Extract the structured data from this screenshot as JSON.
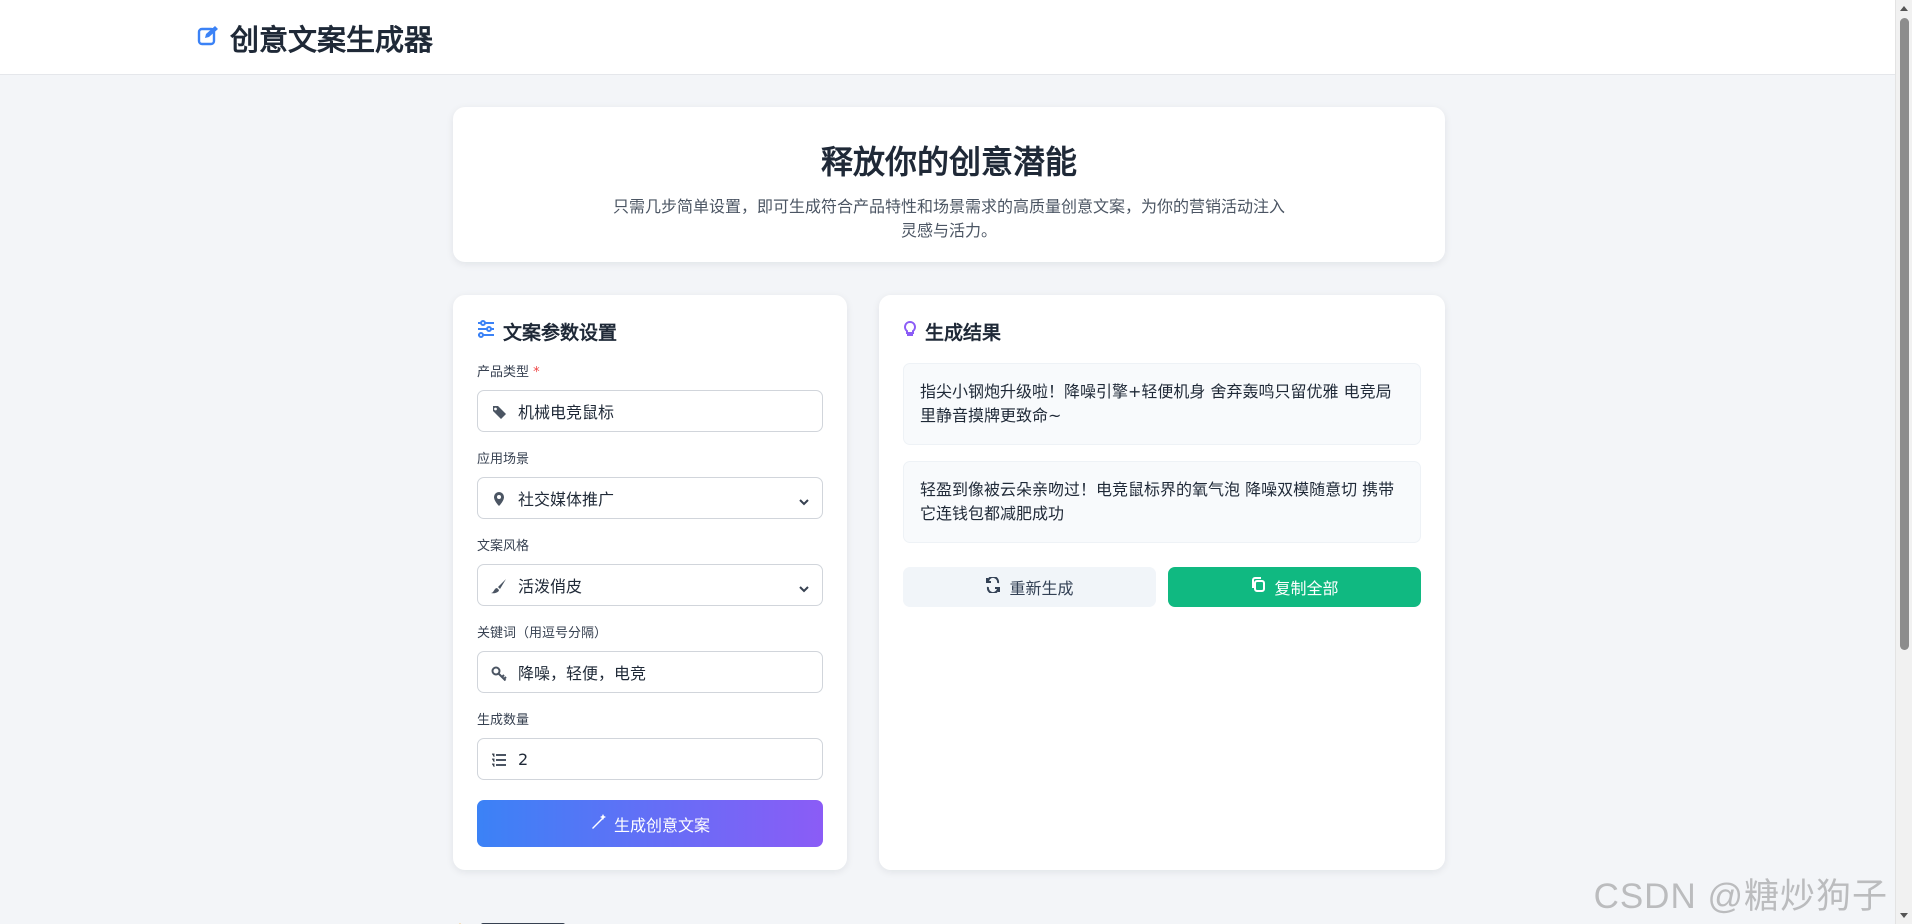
{
  "header": {
    "title": "创意文案生成器",
    "accent": "#3b82f6"
  },
  "hero": {
    "title": "释放你的创意潜能",
    "description": "只需几步简单设置，即可生成符合产品特性和场景需求的高质量创意文案，为你的营销活动注入灵感与活力。"
  },
  "params": {
    "title": "文案参数设置",
    "fields": [
      {
        "label": "产品类型",
        "required_mark": "*",
        "value": "机械电竞鼠标",
        "icon": "tag-icon"
      },
      {
        "label": "应用场景",
        "value": "社交媒体推广",
        "icon": "location-pin-icon"
      },
      {
        "label": "文案风格",
        "value": "活泼俏皮",
        "icon": "paint-brush-icon"
      },
      {
        "label": "关键词（用逗号分隔）",
        "value": "降噪，轻便，电竞",
        "icon": "key-icon"
      },
      {
        "label": "生成数量",
        "value": "2",
        "icon": "list-icon"
      }
    ],
    "generate_label": "生成创意文案"
  },
  "result": {
    "title": "生成结果",
    "items": [
      "指尖小钢炮升级啦！降噪引擎+轻便机身 舍弃轰鸣只留优雅 电竞局里静音摸牌更致命~",
      "轻盈到像被云朵亲吻过！电竞鼠标界的氧气泡 降噪双模随意切 携带它连钱包都减肥成功"
    ],
    "regenerate_label": "重新生成",
    "copy_label": "复制全部"
  },
  "watermark": "CSDN @糖炒狗子",
  "colors": {
    "green": "#10b981",
    "gradient_start": "#3b82f6",
    "gradient_end": "#8b5cf6",
    "lightbulb": "#8b5cf6"
  }
}
